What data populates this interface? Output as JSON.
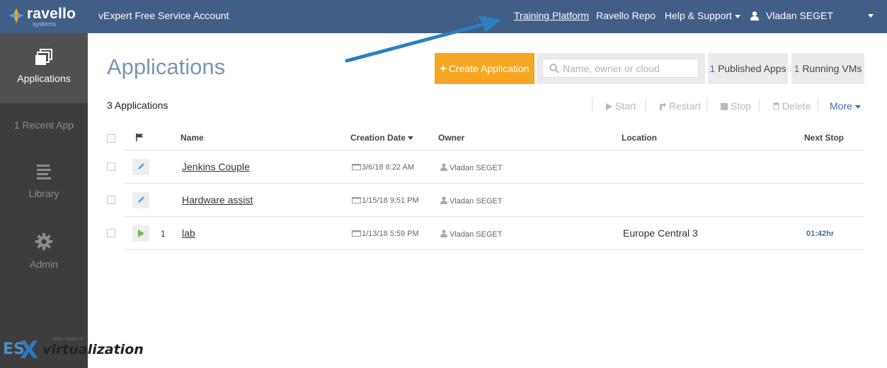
{
  "header": {
    "logo_text": "ravello",
    "logo_sub": "systems",
    "account": "vExpert Free Service Account",
    "nav": [
      "Training Platform",
      "Ravello Repo",
      "Help & Support"
    ],
    "user": "Vladan SEGET"
  },
  "sidebar": {
    "items": [
      {
        "label": "Applications",
        "icon": "stacked-windows-icon",
        "active": true
      },
      {
        "label": "1 Recent App",
        "icon": "",
        "active": false
      },
      {
        "label": "Library",
        "icon": "library-icon",
        "active": false
      },
      {
        "label": "Admin",
        "icon": "gear-icon",
        "active": false
      }
    ]
  },
  "watermark": {
    "es": "ES",
    "x": "X",
    "virt": "virtualization",
    "url": "www.vladan.fr"
  },
  "main": {
    "title": "Applications",
    "create_button": "Create Application",
    "search_placeholder": "Name, owner or cloud",
    "published": {
      "count": "1",
      "label": "Published Apps"
    },
    "running": {
      "count": "1",
      "label": "Running VMs"
    },
    "app_count": "3 Applications",
    "actions": [
      "Start",
      "Restart",
      "Stop",
      "Delete"
    ],
    "more": "More"
  },
  "table": {
    "columns": [
      "Name",
      "Creation Date",
      "Owner",
      "Location",
      "Next Stop"
    ],
    "rows": [
      {
        "status": "edit",
        "vm_count": "",
        "name": "Jenkins Couple",
        "date": "3/6/18 8:22 AM",
        "owner": "Vladan SEGET",
        "location": "",
        "next_stop": ""
      },
      {
        "status": "edit",
        "vm_count": "",
        "name": "Hardware assist",
        "date": "1/15/18 9:51 PM",
        "owner": "Vladan SEGET",
        "location": "",
        "next_stop": ""
      },
      {
        "status": "running",
        "vm_count": "1",
        "name": "lab",
        "date": "1/13/18 5:59 PM",
        "owner": "Vladan SEGET",
        "location": "Europe Central 3",
        "next_stop": "01:42hr"
      }
    ]
  },
  "colors": {
    "topbar": "#415e86",
    "sidebar": "#3d3d3d",
    "accent": "#f5a623",
    "link": "#3a6fb0",
    "annotation_arrow": "#2c7fc1"
  }
}
